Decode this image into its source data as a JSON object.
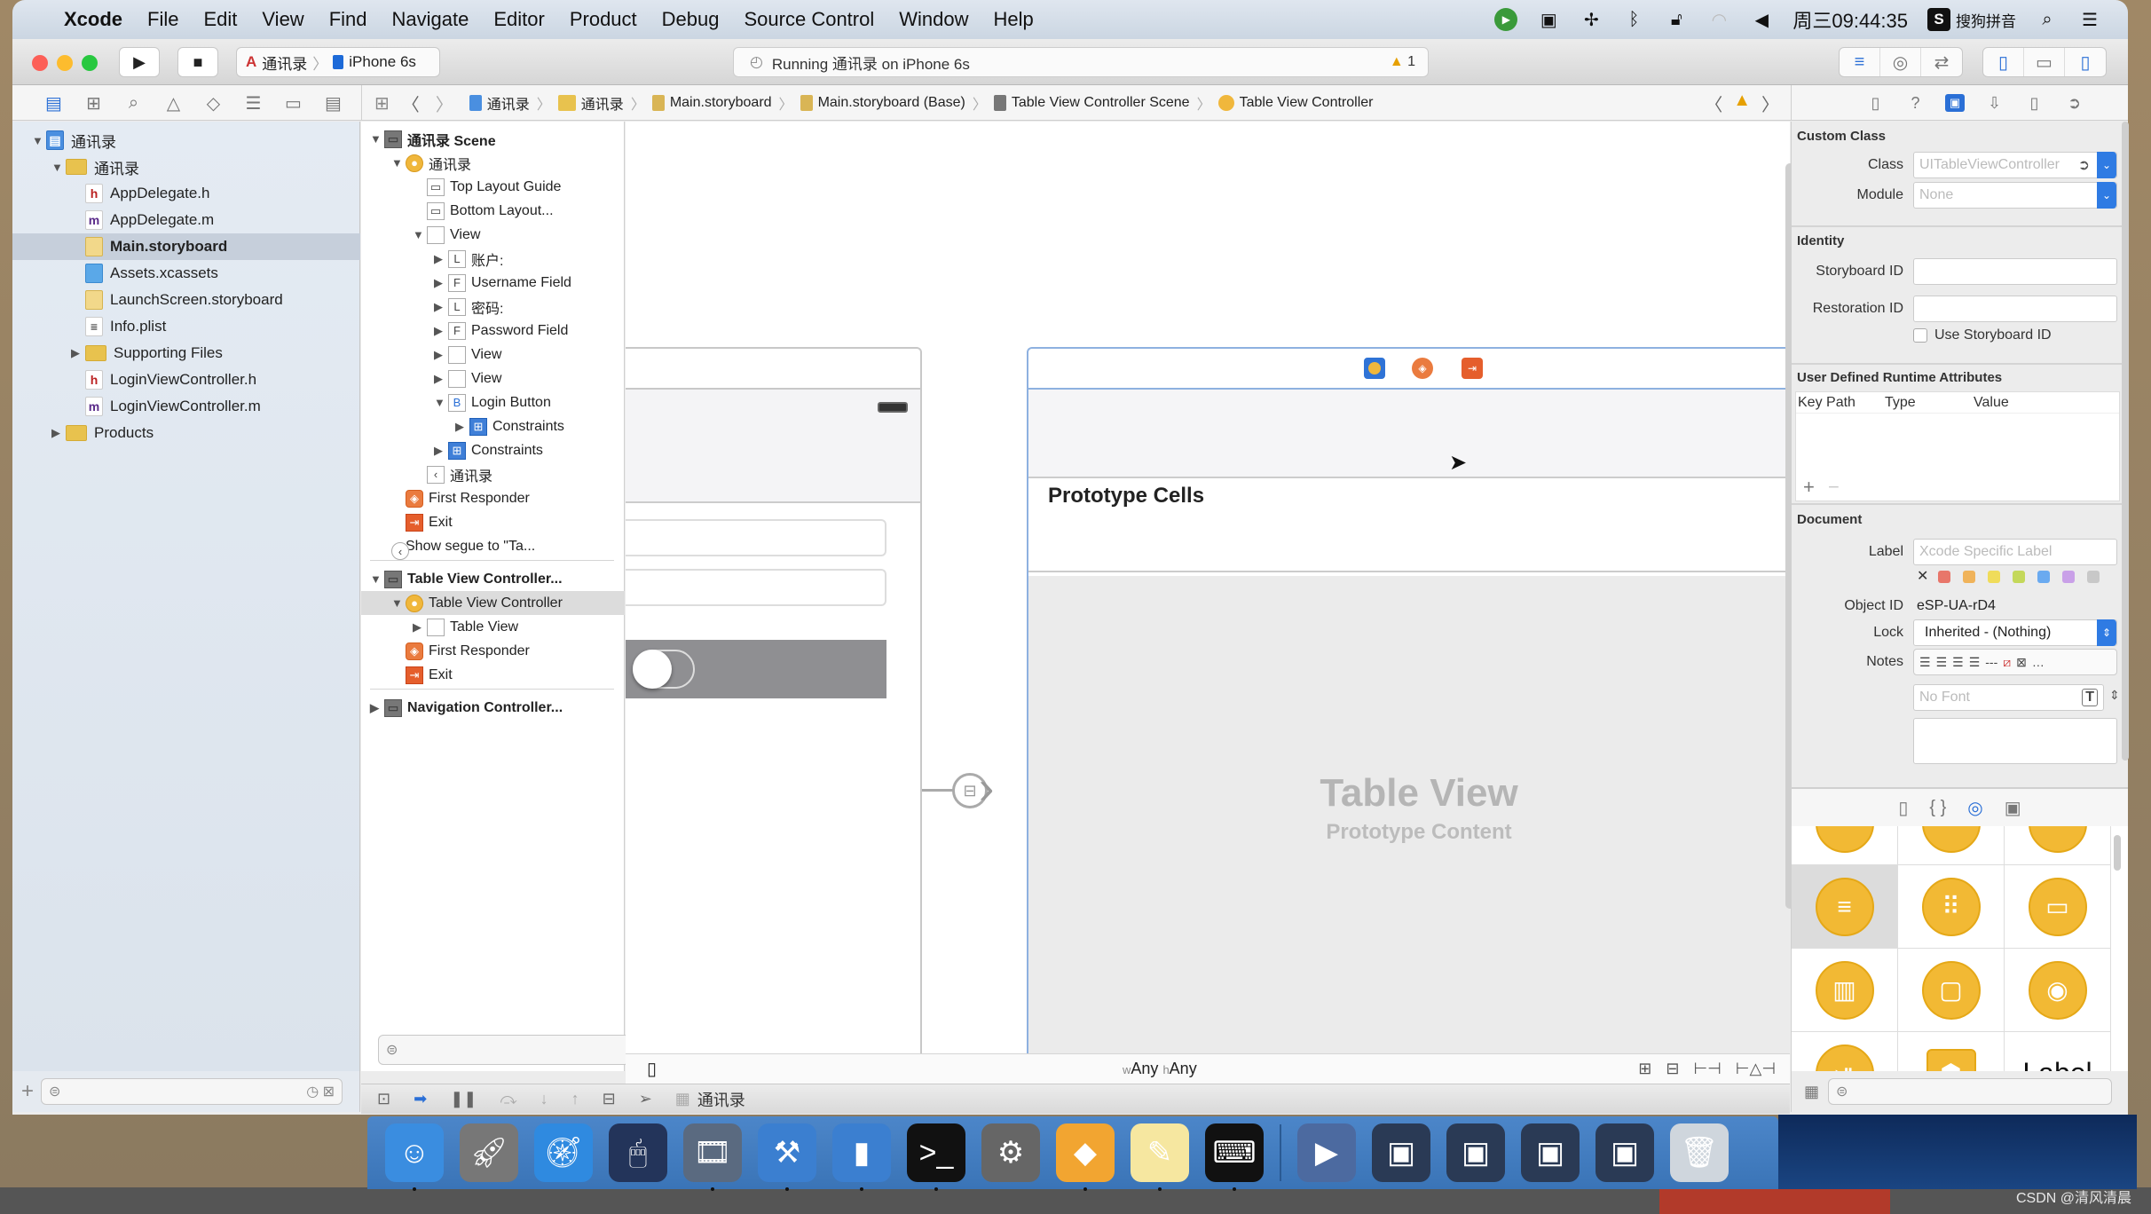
{
  "menubar": {
    "app_name": "Xcode",
    "items": [
      "File",
      "Edit",
      "View",
      "Find",
      "Navigate",
      "Editor",
      "Product",
      "Debug",
      "Source Control",
      "Window",
      "Help"
    ],
    "clock": "周三09:44:35",
    "input_method": "搜狗拼音",
    "status_icons": [
      "app-status-icon",
      "camera-icon",
      "move-icon",
      "bluetooth-icon",
      "lock-icon",
      "wifi-icon",
      "volume-icon"
    ]
  },
  "toolbar": {
    "scheme": "通讯录",
    "device": "iPhone 6s",
    "activity": "Running 通讯录 on iPhone 6s",
    "warning_count": "1"
  },
  "jumpbar": {
    "crumbs": [
      "通讯录",
      "通讯录",
      "Main.storyboard",
      "Main.storyboard (Base)",
      "Table View Controller Scene",
      "Table View Controller"
    ]
  },
  "navigator": {
    "items": [
      {
        "label": "通讯录",
        "type": "project",
        "level": 0,
        "expanded": true
      },
      {
        "label": "通讯录",
        "type": "folder",
        "level": 1,
        "expanded": true
      },
      {
        "label": "AppDelegate.h",
        "type": "h",
        "level": 2
      },
      {
        "label": "AppDelegate.m",
        "type": "m",
        "level": 2
      },
      {
        "label": "Main.storyboard",
        "type": "storyboard",
        "level": 2,
        "selected": true
      },
      {
        "label": "Assets.xcassets",
        "type": "xcassets",
        "level": 2
      },
      {
        "label": "LaunchScreen.storyboard",
        "type": "storyboard",
        "level": 2
      },
      {
        "label": "Info.plist",
        "type": "plist",
        "level": 2
      },
      {
        "label": "Supporting Files",
        "type": "folder",
        "level": 2,
        "expanded": false
      },
      {
        "label": "LoginViewController.h",
        "type": "h",
        "level": 2
      },
      {
        "label": "LoginViewController.m",
        "type": "m",
        "level": 2
      },
      {
        "label": "Products",
        "type": "folder",
        "level": 1,
        "expanded": false
      }
    ]
  },
  "outline": {
    "items": [
      {
        "label": "通讯录 Scene",
        "icon": "scene",
        "level": 0,
        "tri": "down",
        "bold": true
      },
      {
        "label": "通讯录",
        "icon": "vc",
        "level": 1,
        "tri": "down"
      },
      {
        "label": "Top Layout Guide",
        "icon": "guide",
        "level": 2
      },
      {
        "label": "Bottom Layout...",
        "icon": "guide",
        "level": 2
      },
      {
        "label": "View",
        "icon": "view",
        "level": 2,
        "tri": "down"
      },
      {
        "label": "账户:",
        "icon": "L",
        "level": 3,
        "tri": "right"
      },
      {
        "label": "Username Field",
        "icon": "F",
        "level": 3,
        "tri": "right"
      },
      {
        "label": "密码:",
        "icon": "L",
        "level": 3,
        "tri": "right"
      },
      {
        "label": "Password Field",
        "icon": "F",
        "level": 3,
        "tri": "right"
      },
      {
        "label": "View",
        "icon": "view",
        "level": 3,
        "tri": "right"
      },
      {
        "label": "View",
        "icon": "view",
        "level": 3,
        "tri": "right"
      },
      {
        "label": "Login Button",
        "icon": "B",
        "level": 3,
        "tri": "down"
      },
      {
        "label": "Constraints",
        "icon": "constraints",
        "level": 4,
        "tri": "right"
      },
      {
        "label": "Constraints",
        "icon": "constraints",
        "level": 3,
        "tri": "right"
      },
      {
        "label": "通讯录",
        "icon": "navitem",
        "level": 2
      },
      {
        "label": "First Responder",
        "icon": "fr",
        "level": 1
      },
      {
        "label": "Exit",
        "icon": "exit",
        "level": 1
      },
      {
        "label": "Show segue to \"Ta...",
        "icon": "segue",
        "level": 1
      },
      {
        "label": "Table View Controller...",
        "icon": "scene",
        "level": 0,
        "tri": "down",
        "bold": true
      },
      {
        "label": "Table View Controller",
        "icon": "vc",
        "level": 1,
        "tri": "down",
        "selected": true
      },
      {
        "label": "Table View",
        "icon": "view",
        "level": 2,
        "tri": "right"
      },
      {
        "label": "First Responder",
        "icon": "fr",
        "level": 1
      },
      {
        "label": "Exit",
        "icon": "exit",
        "level": 1
      },
      {
        "label": "Navigation Controller...",
        "icon": "scene",
        "level": 0,
        "tri": "right",
        "bold": true
      }
    ]
  },
  "canvas": {
    "prototype_cells_label": "Prototype Cells",
    "table_view_title": "Table View",
    "table_view_subtitle": "Prototype Content",
    "size_class_w_prefix": "w",
    "size_class_w": "Any",
    "size_class_h_prefix": "h",
    "size_class_h": "Any"
  },
  "debugbar": {
    "target": "通讯录"
  },
  "inspector": {
    "custom_class_title": "Custom Class",
    "class_label": "Class",
    "class_placeholder": "UITableViewController",
    "module_label": "Module",
    "module_placeholder": "None",
    "identity_title": "Identity",
    "storyboard_id_label": "Storyboard ID",
    "storyboard_id_value": "",
    "restoration_id_label": "Restoration ID",
    "restoration_id_value": "",
    "use_storyboard_id_label": "Use Storyboard ID",
    "use_storyboard_id_checked": false,
    "udra_title": "User Defined Runtime Attributes",
    "udra_columns": [
      "Key Path",
      "Type",
      "Value"
    ],
    "document_title": "Document",
    "label_label": "Label",
    "label_placeholder": "Xcode Specific Label",
    "tag_colors": [
      "#e8766a",
      "#f0b35a",
      "#f0dc5a",
      "#c4d85a",
      "#6aaaf0",
      "#c9a0e8",
      "#c8c8c8"
    ],
    "object_id_label": "Object ID",
    "object_id_value": "eSP-UA-rD4",
    "lock_label": "Lock",
    "lock_value": "Inherited - (Nothing)",
    "notes_label": "Notes",
    "font_placeholder": "No Font"
  },
  "library": {
    "items": [
      "Table View Controller",
      "Collection View Controller",
      "Tab Bar Controller",
      "Split View Controller",
      "Page View Controller",
      "GLKit View Controller",
      "AVKit Player View Controller",
      "Object",
      "Label"
    ],
    "label_text": "Label"
  },
  "dock": {
    "apps": [
      "Finder",
      "Launchpad",
      "Safari",
      "Mouse",
      "Photo Booth",
      "Xcode",
      "Simulator",
      "Terminal",
      "System Preferences",
      "Sketch",
      "Notes",
      "Console",
      "QuickTime",
      "Window 1",
      "Window 2",
      "Window 3",
      "Window 4",
      "Trash"
    ]
  },
  "watermark": "CSDN @清风清晨",
  "colors": {
    "accent": "#2a6fd6",
    "warning": "#e6a000",
    "vc_yellow": "#f0b73c",
    "exit_orange": "#e55e2c"
  }
}
